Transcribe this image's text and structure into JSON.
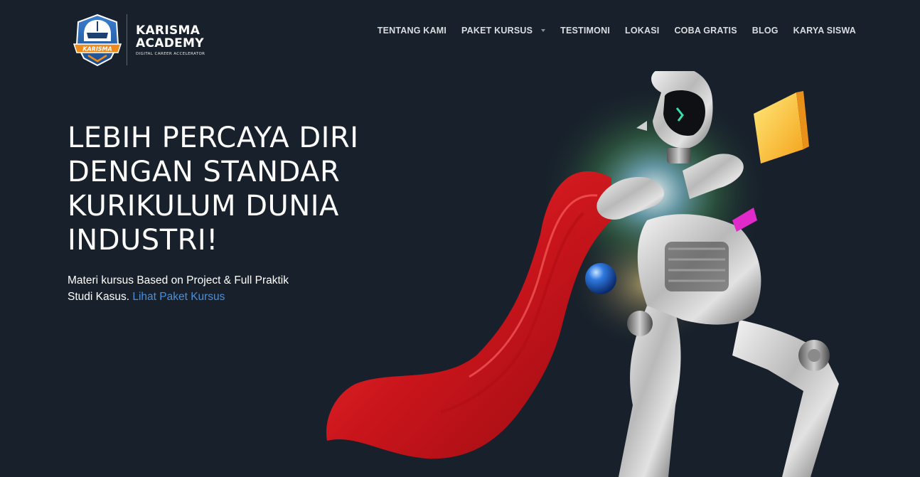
{
  "brand": {
    "name_line1": "KARISMA",
    "name_line2": "ACADEMY",
    "tagline": "DIGITAL CAREER ACCELERATOR",
    "emblem_text": "KARISMA",
    "colors": {
      "background": "#18212b",
      "accent_blue": "#2b6bb8",
      "accent_orange": "#f08a1c",
      "link": "#4a8fd9"
    }
  },
  "nav": {
    "items": [
      {
        "label": "TENTANG KAMI"
      },
      {
        "label": "PAKET KURSUS",
        "has_dropdown": true,
        "icon": "chevron-down-icon"
      },
      {
        "label": "TESTIMONI"
      },
      {
        "label": "LOKASI"
      },
      {
        "label": "COBA GRATIS"
      },
      {
        "label": "BLOG"
      },
      {
        "label": "KARYA SISWA"
      }
    ]
  },
  "hero": {
    "title": "LEBIH PERCAYA DIRI DENGAN STANDAR KURIKULUM DUNIA INDUSTRI!",
    "subtitle": "Materi kursus Based on Project & Full Praktik Studi Kasus.",
    "link_label": "Lihat Paket Kursus",
    "illustration": "robot-with-red-cape-illustration"
  }
}
